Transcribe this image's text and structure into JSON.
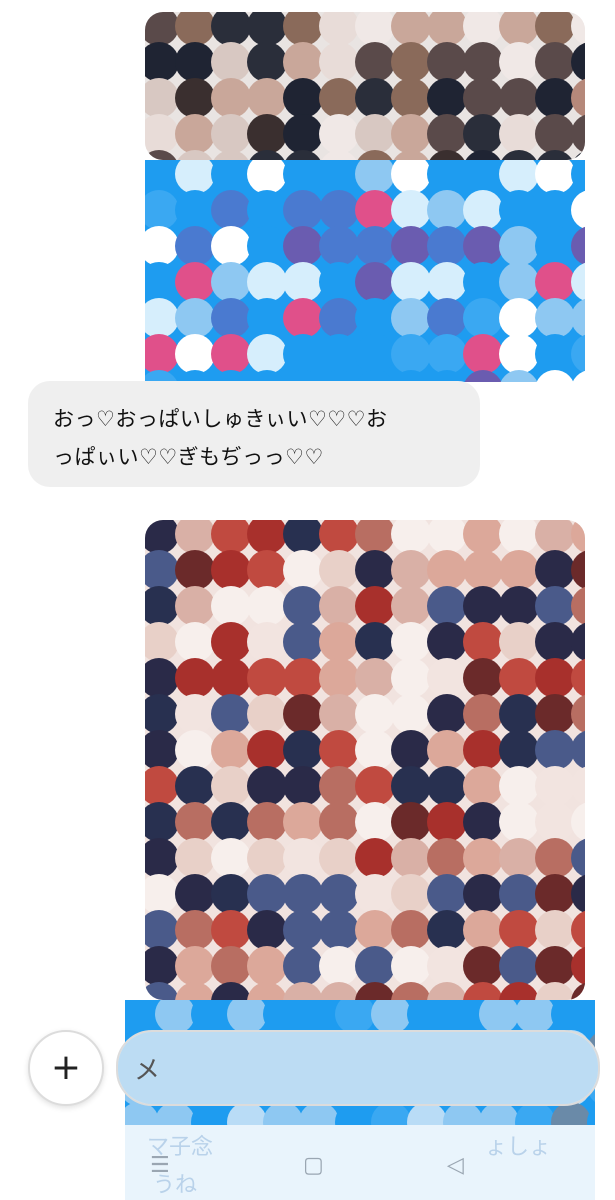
{
  "messages": [
    {
      "type": "image",
      "id": "photo-1",
      "pixelated": true
    },
    {
      "type": "image",
      "id": "screenshot-blue",
      "pixelated": true
    },
    {
      "type": "text",
      "direction": "incoming",
      "lines": [
        "おっ♡おっぱいしゅきぃい♡♡♡お",
        "っぱぃい♡♡ぎもぢっっ♡♡"
      ]
    },
    {
      "type": "image",
      "id": "photo-2",
      "pixelated": true
    },
    {
      "type": "image",
      "id": "screenshot-blue-2",
      "pixelated": true
    }
  ],
  "composer": {
    "add_label": "+",
    "placeholder": "メ"
  },
  "nav": {
    "menu_icon": "menu-icon",
    "home_icon": "home-square-icon",
    "back_icon": "back-triangle-icon",
    "blurred_left": "マ子念",
    "blurred_right": "ょしょ",
    "blurred_bottom": "うね"
  },
  "colors": {
    "accent_blue": "#1d9bf0",
    "bubble_gray": "#efefef",
    "nav_bg": "#e9f4fc"
  }
}
